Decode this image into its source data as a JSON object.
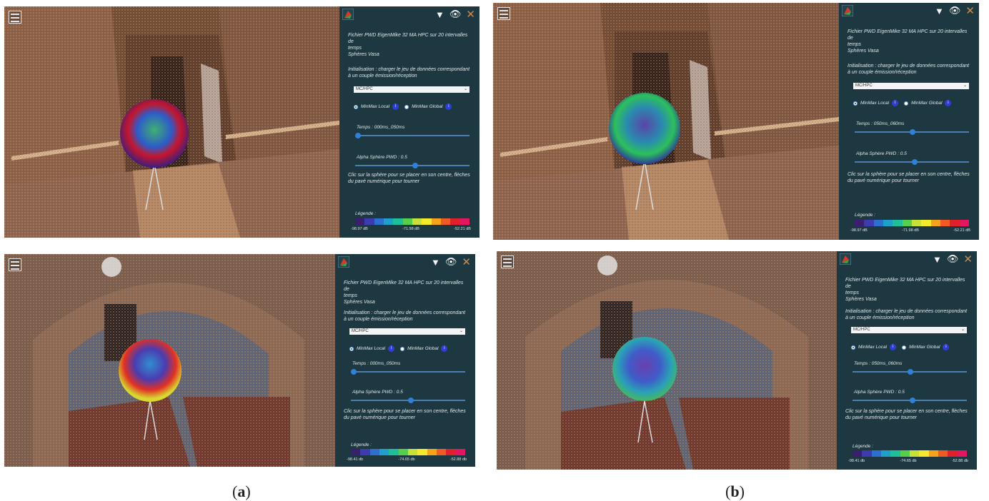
{
  "panel": {
    "title_line1": "Fichier PWD EigenMike 32 MA HPC sur 20 intervalles de",
    "title_line2": "temps",
    "title_line3": "Sphères Vasa",
    "init_text": "Initialisation : charger le jeu de données correspondant à un couple émission/réception",
    "selected_dataset": "MC/HPC",
    "radio_local": "MinMax Local",
    "radio_global": "MinMax Global",
    "info_symbol": "i",
    "time_label": "Temps :",
    "alpha_label": "Alpha Sphère PWD :",
    "alpha_value": "0.5",
    "hint_text": "Clic sur la sphère pour se placer en son centre, flèches du pavé numérique pour tourner",
    "legend_label": "Légende :",
    "tool_dropdown_icon": "▼",
    "tool_eye_icon": "👁",
    "tool_close_icon": "✕"
  },
  "views": [
    {
      "time_value": "000ms_050ms",
      "legend_min": "-98.97 dB",
      "legend_mid": "-71.98 dB",
      "legend_max": "-52.21 dB"
    },
    {
      "time_value": "050ms_060ms",
      "legend_min": "-98.97 dB",
      "legend_mid": "-71.98 dB",
      "legend_max": "-52.21 dB"
    },
    {
      "time_value": "000ms_050ms",
      "legend_min": "-98.41 db",
      "legend_mid": "-74.65 db",
      "legend_max": "-52.88 db"
    },
    {
      "time_value": "050ms_060ms",
      "legend_min": "-98.41 db",
      "legend_mid": "-74.65 db",
      "legend_max": "-52.88 db"
    }
  ],
  "legend_colors": [
    "#3b1f6e",
    "#3d3bb0",
    "#2d6fcf",
    "#1fa0c8",
    "#1fbf9a",
    "#57cf4c",
    "#c7e13a",
    "#f5e92b",
    "#f6a21d",
    "#ef5a25",
    "#e0202a",
    "#e3165f"
  ],
  "captions": {
    "left": "a",
    "right": "b"
  }
}
